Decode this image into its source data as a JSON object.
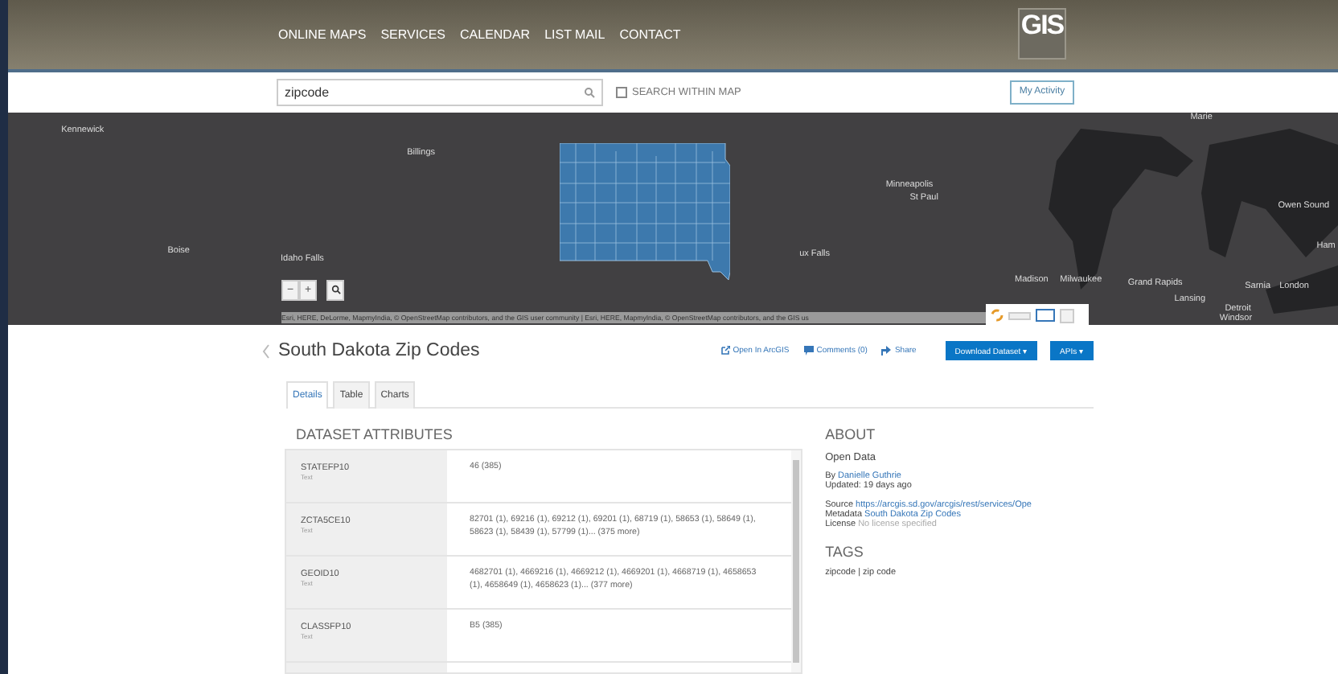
{
  "nav": {
    "items": [
      "ONLINE MAPS",
      "SERVICES",
      "CALENDAR",
      "LIST MAIL",
      "CONTACT"
    ],
    "logo": "GIS"
  },
  "search": {
    "value": "zipcode",
    "within_map": {
      "label": "SEARCH WITHIN MAP",
      "checked": false
    },
    "activity_button": "My Activity"
  },
  "map": {
    "labels": [
      "Kennewick",
      "Billings",
      "Boise",
      "Idaho Falls",
      "Minneapolis",
      "St Paul",
      "ux Falls",
      "Madison",
      "Milwaukee",
      "Grand Rapids",
      "Lansing",
      "Sarnia",
      "London",
      "Owen Sound",
      "Detroit",
      "Windsor",
      "Marie",
      "Ham"
    ],
    "zoom_out": "−",
    "zoom_in": "+",
    "attribution": "Esri, HERE, DeLorme, MapmyIndia, © OpenStreetMap contributors, and the GIS user community | Esri, HERE, MapmyIndia, © OpenStreetMap contributors, and the GIS us"
  },
  "dataset": {
    "title": "South Dakota Zip Codes",
    "links": [
      "Open In ArcGIS",
      "Comments (0)",
      "Share"
    ],
    "buttons": [
      "Download Dataset ▾",
      "APIs ▾"
    ]
  },
  "tabs": [
    {
      "label": "Details",
      "selected": true
    },
    {
      "label": "Table",
      "selected": false
    },
    {
      "label": "Charts",
      "selected": false
    }
  ],
  "attributes": {
    "heading": "DATASET ATTRIBUTES",
    "rows": [
      {
        "name": "STATEFP10",
        "type": "Text",
        "value": "46 (385)"
      },
      {
        "name": "ZCTA5CE10",
        "type": "Text",
        "value": "82701 (1), 69216 (1), 69212 (1), 69201 (1), 68719 (1), 58653 (1), 58649 (1), 58623 (1), 58439 (1), 57799 (1)... (375 more)"
      },
      {
        "name": "GEOID10",
        "type": "Text",
        "value": "4682701 (1), 4669216 (1), 4669212 (1), 4669201 (1), 4668719 (1), 4658653 (1), 4658649 (1), 4658623 (1)... (377 more)"
      },
      {
        "name": "CLASSFP10",
        "type": "Text",
        "value": "B5 (385)"
      }
    ]
  },
  "about": {
    "heading": "ABOUT",
    "subtitle": "Open Data",
    "by_label": "By",
    "author": "Danielle Guthrie",
    "updated": "Updated: 19 days ago",
    "meta": [
      {
        "label": "Source",
        "value": "https://arcgis.sd.gov/arcgis/rest/services/Ope",
        "kind": "link"
      },
      {
        "label": "Metadata",
        "value": "South Dakota Zip Codes",
        "kind": "link"
      },
      {
        "label": "License",
        "value": "No license specified",
        "kind": "muted"
      }
    ],
    "tags_heading": "TAGS",
    "tags": "zipcode | zip code"
  }
}
